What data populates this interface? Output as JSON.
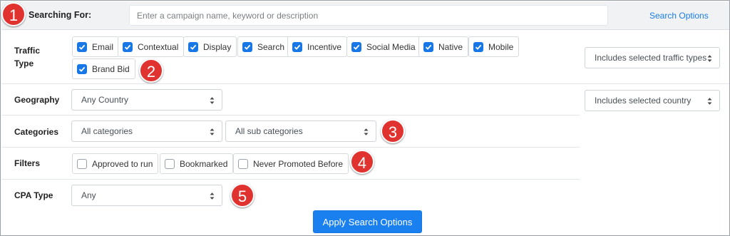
{
  "header": {
    "label": "Searching For:",
    "search_placeholder": "Enter a campaign name, keyword or description",
    "search_value": "",
    "search_options_link": "Search Options"
  },
  "badges": [
    "1",
    "2",
    "3",
    "4",
    "5"
  ],
  "traffic_type": {
    "label_line1": "Traffic",
    "label_line2": "Type",
    "options": [
      {
        "label": "Email",
        "checked": true
      },
      {
        "label": "Contextual",
        "checked": true
      },
      {
        "label": "Display",
        "checked": true
      },
      {
        "label": "Search",
        "checked": true
      },
      {
        "label": "Incentive",
        "checked": true
      },
      {
        "label": "Social Media",
        "checked": true
      },
      {
        "label": "Native",
        "checked": true
      },
      {
        "label": "Mobile",
        "checked": true
      },
      {
        "label": "Brand Bid",
        "checked": true
      }
    ],
    "mode_select": "Includes selected traffic types"
  },
  "geography": {
    "label": "Geography",
    "country_select": "Any Country",
    "mode_select": "Includes selected country"
  },
  "categories": {
    "label": "Categories",
    "category_select": "All categories",
    "subcategory_select": "All sub categories"
  },
  "filters": {
    "label": "Filters",
    "options": [
      {
        "label": "Approved to run",
        "checked": false
      },
      {
        "label": "Bookmarked",
        "checked": false
      },
      {
        "label": "Never Promoted Before",
        "checked": false
      }
    ]
  },
  "cpa_type": {
    "label": "CPA Type",
    "select": "Any"
  },
  "apply_button": "Apply Search Options",
  "colors": {
    "accent": "#1a80f0",
    "badge": "#e0322f",
    "header_bg": "#f1f2f4"
  }
}
